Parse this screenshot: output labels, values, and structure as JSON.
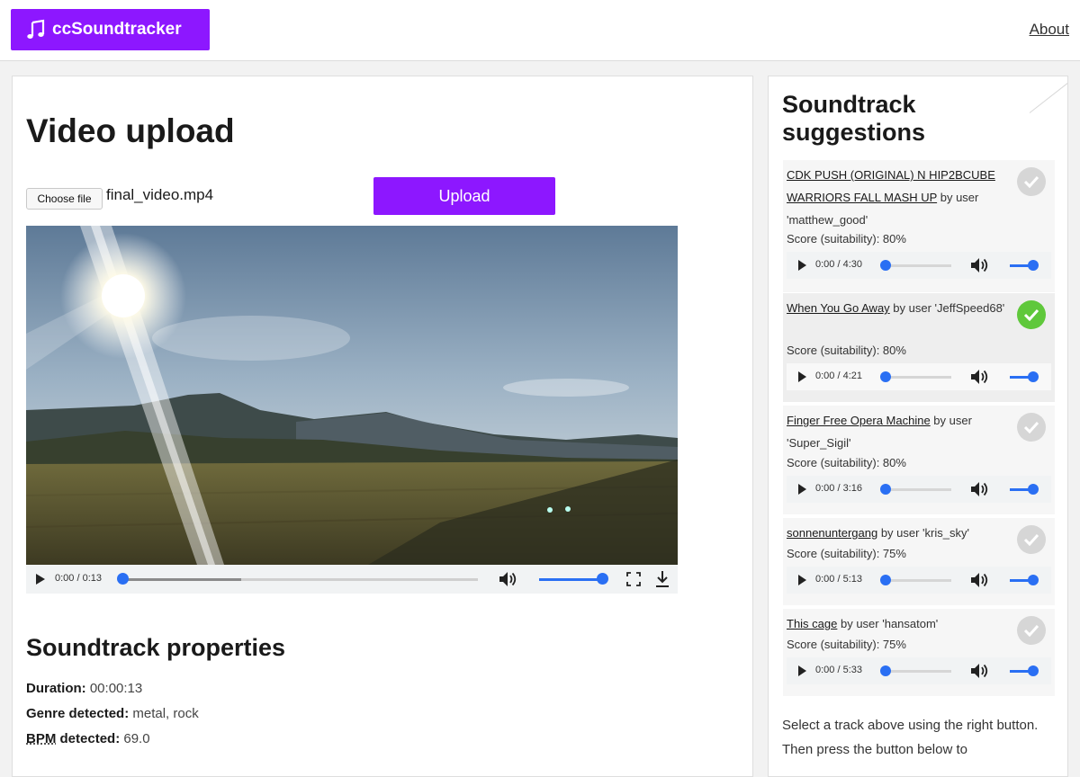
{
  "app": {
    "brand": "ccSoundtracker",
    "about_label": "About",
    "accent_color": "#8d17ff"
  },
  "upload": {
    "title": "Video upload",
    "choose_file_label": "Choose file",
    "file_name": "final_video.mp4",
    "upload_label": "Upload"
  },
  "video_player": {
    "time": "0:00 / 0:13",
    "progress": 0,
    "volume": 1
  },
  "properties": {
    "title": "Soundtrack properties",
    "items": [
      {
        "label": "Duration:",
        "value": "00:00:13"
      },
      {
        "label": "Genre detected:",
        "value": "metal, rock"
      },
      {
        "label": "BPM detected:",
        "value": "69.0",
        "abbr": "BPM",
        "rest": " detected:"
      }
    ]
  },
  "suggestions": {
    "title": "Soundtrack suggestions",
    "tracks": [
      {
        "title": "CDK PUSH (ORIGINAL) N HIP2BCUBE WARRIORS FALL MASH UP",
        "by": " by user 'matthew_good'",
        "score": "Score (suitability): 80%",
        "time": "0:00 / 4:30",
        "selected": false
      },
      {
        "title": "When You Go Away",
        "by": " by user 'JeffSpeed68'",
        "score": "Score (suitability): 80%",
        "time": "0:00 / 4:21",
        "selected": true
      },
      {
        "title": "Finger Free Opera Machine",
        "by": " by user 'Super_Sigil'",
        "score": "Score (suitability): 80%",
        "time": "0:00 / 3:16",
        "selected": false
      },
      {
        "title": "sonnenuntergang",
        "by": " by user 'kris_sky'",
        "score": "Score (suitability): 75%",
        "time": "0:00 / 5:13",
        "selected": false
      },
      {
        "title": "This cage",
        "by": " by user 'hansatom'",
        "score": "Score (suitability): 75%",
        "time": "0:00 / 5:33",
        "selected": false
      }
    ],
    "help_text": "Select a track above using the right button. Then press the button below to"
  }
}
